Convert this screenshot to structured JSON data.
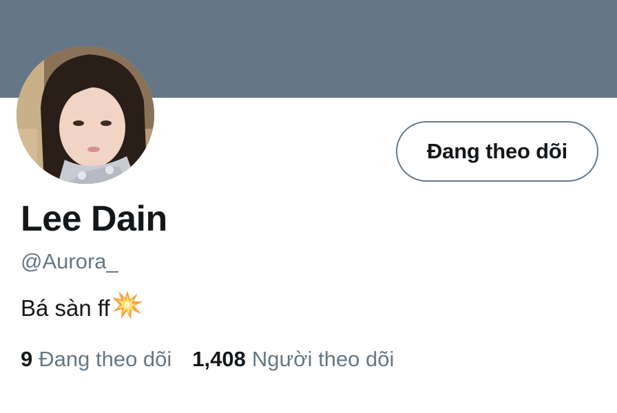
{
  "profile": {
    "display_name": "Lee Dain",
    "handle": "@Aurora_",
    "bio": "Bá sàn ff",
    "bio_emoji": "collision-emoji-icon",
    "follow_button_label": "Đang theo dõi",
    "banner_color": "#657786"
  },
  "stats": {
    "following_count": "9",
    "following_label": "Đang theo dõi",
    "followers_count": "1,408",
    "followers_label": "Người theo dõi"
  },
  "colors": {
    "text_primary": "#14171a",
    "text_secondary": "#657786"
  }
}
